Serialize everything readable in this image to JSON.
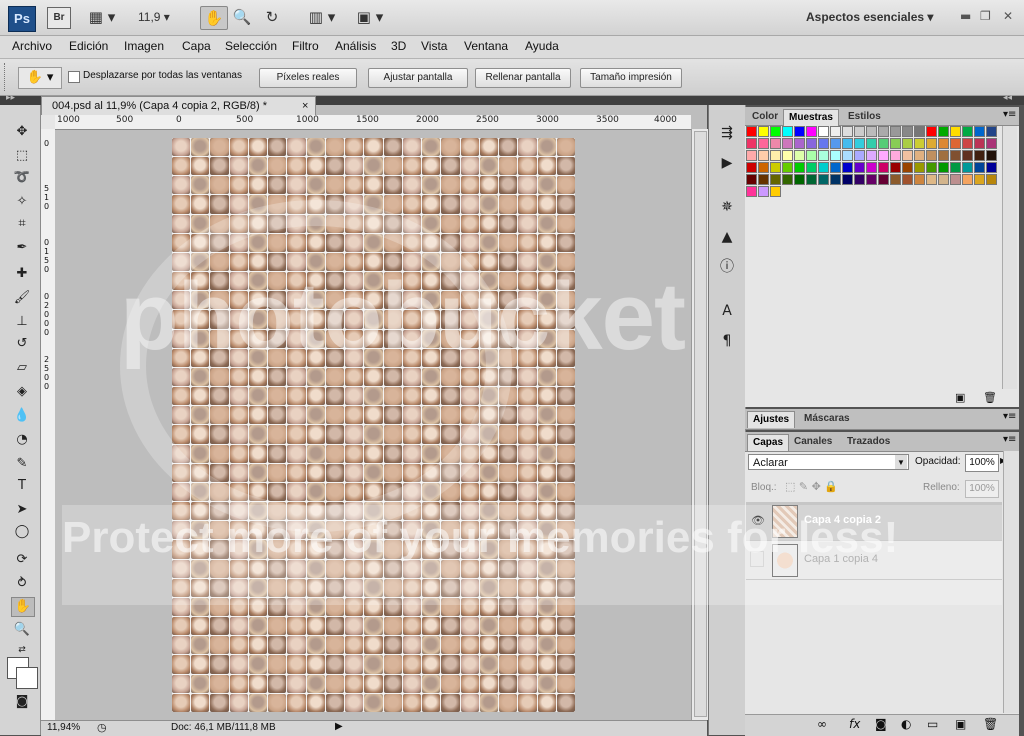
{
  "appbar": {
    "ps_logo": "Ps",
    "br_logo": "Br",
    "zoom_value": "11,9",
    "workspace": "Aspectos esenciales"
  },
  "menu": [
    "Archivo",
    "Edición",
    "Imagen",
    "Capa",
    "Selección",
    "Filtro",
    "Análisis",
    "3D",
    "Vista",
    "Ventana",
    "Ayuda"
  ],
  "options": {
    "scroll_all_label": "Desplazarse por todas las ventanas",
    "btn_actual_pixels": "Píxeles reales",
    "btn_fit_screen": "Ajustar pantalla",
    "btn_fill_screen": "Rellenar pantalla",
    "btn_print_size": "Tamaño impresión"
  },
  "document": {
    "tab_title": "004.psd al 11,9% (Capa 4 copia 2, RGB/8) *",
    "tab_close": "×",
    "ruler_h_labels": [
      "1000",
      "500",
      "0",
      "500",
      "1000",
      "1500",
      "2000",
      "2500",
      "3000",
      "3500",
      "4000"
    ],
    "ruler_v_labels": [
      "0",
      "5",
      "1",
      "0",
      "0",
      "1",
      "5",
      "0",
      "0",
      "2",
      "0",
      "0",
      "0",
      "2",
      "5",
      "0",
      "0"
    ]
  },
  "status": {
    "zoom": "11,94%",
    "doc_info": "Doc: 46,1 MB/111,8 MB"
  },
  "panels": {
    "swatch_tabs": [
      "Color",
      "Muestras",
      "Estilos"
    ],
    "adjust_tabs": [
      "Ajustes",
      "Máscaras"
    ],
    "layer_tabs": [
      "Capas",
      "Canales",
      "Trazados"
    ],
    "blend_mode": "Aclarar",
    "opacity_label": "Opacidad:",
    "opacity_value": "100%",
    "lock_label": "Bloq.:",
    "fill_label": "Relleno:",
    "fill_value": "100%",
    "layers": [
      {
        "name": "Capa 4 copia 2",
        "visible": true,
        "selected": true
      },
      {
        "name": "Capa 1 copia 4",
        "visible": false,
        "selected": false
      }
    ]
  },
  "swatch_colors": [
    "#ff0000",
    "#ffff00",
    "#00ff00",
    "#00ffff",
    "#0000ff",
    "#ff00ff",
    "#ffffff",
    "#eeeeee",
    "#dddddd",
    "#cccccc",
    "#bbbbbb",
    "#aaaaaa",
    "#999999",
    "#888888",
    "#777777",
    "#ff0000",
    "#00aa00",
    "#ffdd00",
    "#00aa44",
    "#0066cc",
    "#224488",
    "#ee3366",
    "#ff6699",
    "#ee88aa",
    "#cc77bb",
    "#aa66cc",
    "#8866dd",
    "#6677ee",
    "#5599ee",
    "#44bbee",
    "#33ccdd",
    "#33ccaa",
    "#55cc77",
    "#88cc55",
    "#aacc44",
    "#cccc33",
    "#ddaa33",
    "#dd8833",
    "#dd6633",
    "#cc4444",
    "#bb3355",
    "#aa3377",
    "#ffaaaa",
    "#ffccaa",
    "#ffeeaa",
    "#ffffaa",
    "#ddffaa",
    "#aaffaa",
    "#aaffdd",
    "#aaffff",
    "#aaddff",
    "#aaaaff",
    "#ddaaff",
    "#ffaaff",
    "#ffaadd",
    "#f0c0a0",
    "#e0b080",
    "#c09060",
    "#a07040",
    "#805030",
    "#603020",
    "#402010",
    "#201008",
    "#cc0000",
    "#cc6600",
    "#cccc00",
    "#66cc00",
    "#00cc00",
    "#00cc66",
    "#00cccc",
    "#0066cc",
    "#0000cc",
    "#6600cc",
    "#cc00cc",
    "#cc0066",
    "#990000",
    "#994400",
    "#999900",
    "#449900",
    "#009900",
    "#009944",
    "#009999",
    "#004499",
    "#000099",
    "#660000",
    "#663300",
    "#666600",
    "#336600",
    "#006600",
    "#006633",
    "#006666",
    "#003366",
    "#000066",
    "#330066",
    "#660066",
    "#660033",
    "#8b5a2b",
    "#a0522d",
    "#cd853f",
    "#deb887",
    "#d2b48c",
    "#bc8f8f",
    "#f4a460",
    "#daa520",
    "#b8860b",
    "#ff3399",
    "#cc99ff",
    "#ffcc00"
  ],
  "watermark": {
    "line1": "photobucket",
    "line2": "Protect more of your memories for less!"
  }
}
